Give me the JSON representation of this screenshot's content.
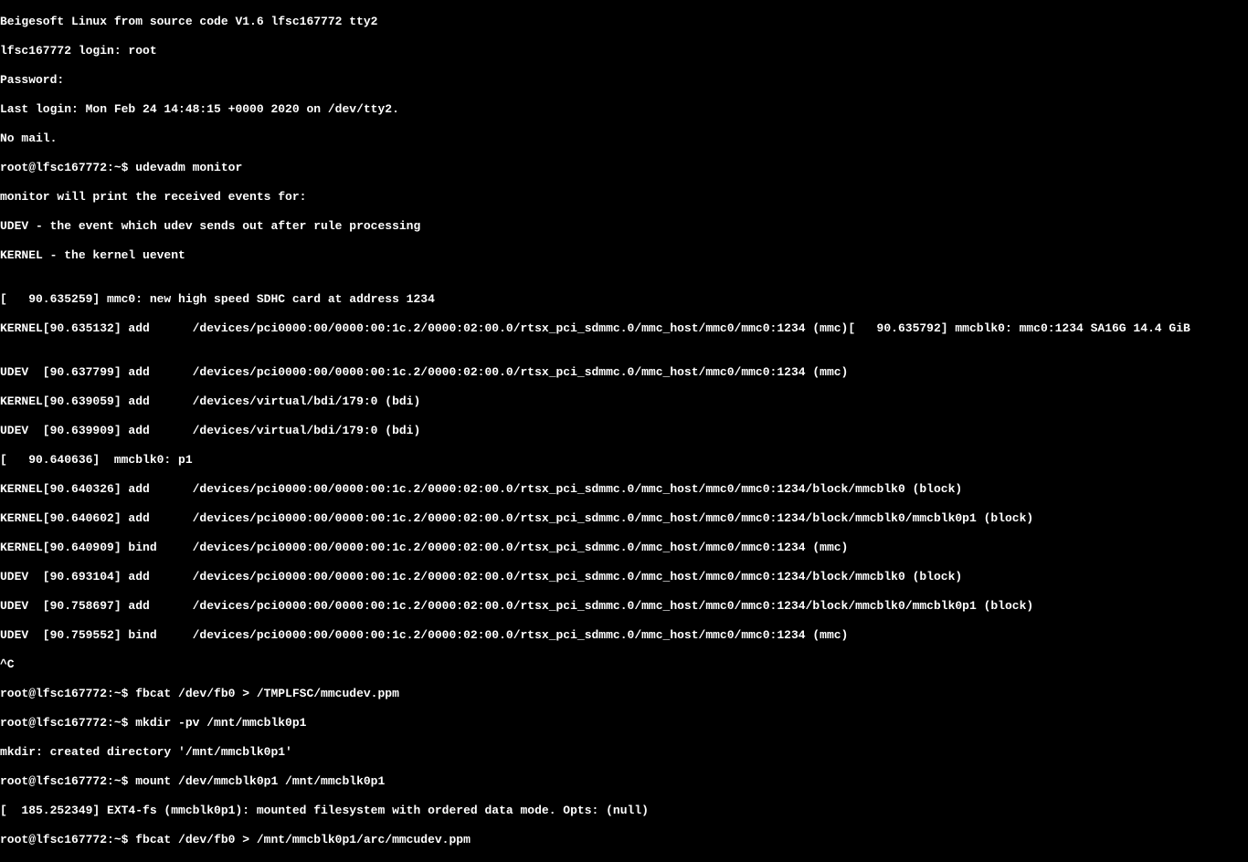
{
  "terminal": {
    "lines": [
      "Beigesoft Linux from source code V1.6 lfsc167772 tty2",
      "lfsc167772 login: root",
      "Password:",
      "Last login: Mon Feb 24 14:48:15 +0000 2020 on /dev/tty2.",
      "No mail.",
      "root@lfsc167772:~$ udevadm monitor",
      "monitor will print the received events for:",
      "UDEV - the event which udev sends out after rule processing",
      "KERNEL - the kernel uevent",
      "",
      "[   90.635259] mmc0: new high speed SDHC card at address 1234",
      "KERNEL[90.635132] add      /devices/pci0000:00/0000:00:1c.2/0000:02:00.0/rtsx_pci_sdmmc.0/mmc_host/mmc0/mmc0:1234 (mmc)[   90.635792] mmcblk0: mmc0:1234 SA16G 14.4 GiB",
      "",
      "UDEV  [90.637799] add      /devices/pci0000:00/0000:00:1c.2/0000:02:00.0/rtsx_pci_sdmmc.0/mmc_host/mmc0/mmc0:1234 (mmc)",
      "KERNEL[90.639059] add      /devices/virtual/bdi/179:0 (bdi)",
      "UDEV  [90.639909] add      /devices/virtual/bdi/179:0 (bdi)",
      "[   90.640636]  mmcblk0: p1",
      "KERNEL[90.640326] add      /devices/pci0000:00/0000:00:1c.2/0000:02:00.0/rtsx_pci_sdmmc.0/mmc_host/mmc0/mmc0:1234/block/mmcblk0 (block)",
      "KERNEL[90.640602] add      /devices/pci0000:00/0000:00:1c.2/0000:02:00.0/rtsx_pci_sdmmc.0/mmc_host/mmc0/mmc0:1234/block/mmcblk0/mmcblk0p1 (block)",
      "KERNEL[90.640909] bind     /devices/pci0000:00/0000:00:1c.2/0000:02:00.0/rtsx_pci_sdmmc.0/mmc_host/mmc0/mmc0:1234 (mmc)",
      "UDEV  [90.693104] add      /devices/pci0000:00/0000:00:1c.2/0000:02:00.0/rtsx_pci_sdmmc.0/mmc_host/mmc0/mmc0:1234/block/mmcblk0 (block)",
      "UDEV  [90.758697] add      /devices/pci0000:00/0000:00:1c.2/0000:02:00.0/rtsx_pci_sdmmc.0/mmc_host/mmc0/mmc0:1234/block/mmcblk0/mmcblk0p1 (block)",
      "UDEV  [90.759552] bind     /devices/pci0000:00/0000:00:1c.2/0000:02:00.0/rtsx_pci_sdmmc.0/mmc_host/mmc0/mmc0:1234 (mmc)",
      "^C",
      "root@lfsc167772:~$ fbcat /dev/fb0 > /TMPLFSC/mmcudev.ppm",
      "root@lfsc167772:~$ mkdir -pv /mnt/mmcblk0p1",
      "mkdir: created directory '/mnt/mmcblk0p1'",
      "root@lfsc167772:~$ mount /dev/mmcblk0p1 /mnt/mmcblk0p1",
      "[  185.252349] EXT4-fs (mmcblk0p1): mounted filesystem with ordered data mode. Opts: (null)",
      "root@lfsc167772:~$ fbcat /dev/fb0 > /mnt/mmcblk0p1/arc/mmcudev.ppm"
    ]
  }
}
